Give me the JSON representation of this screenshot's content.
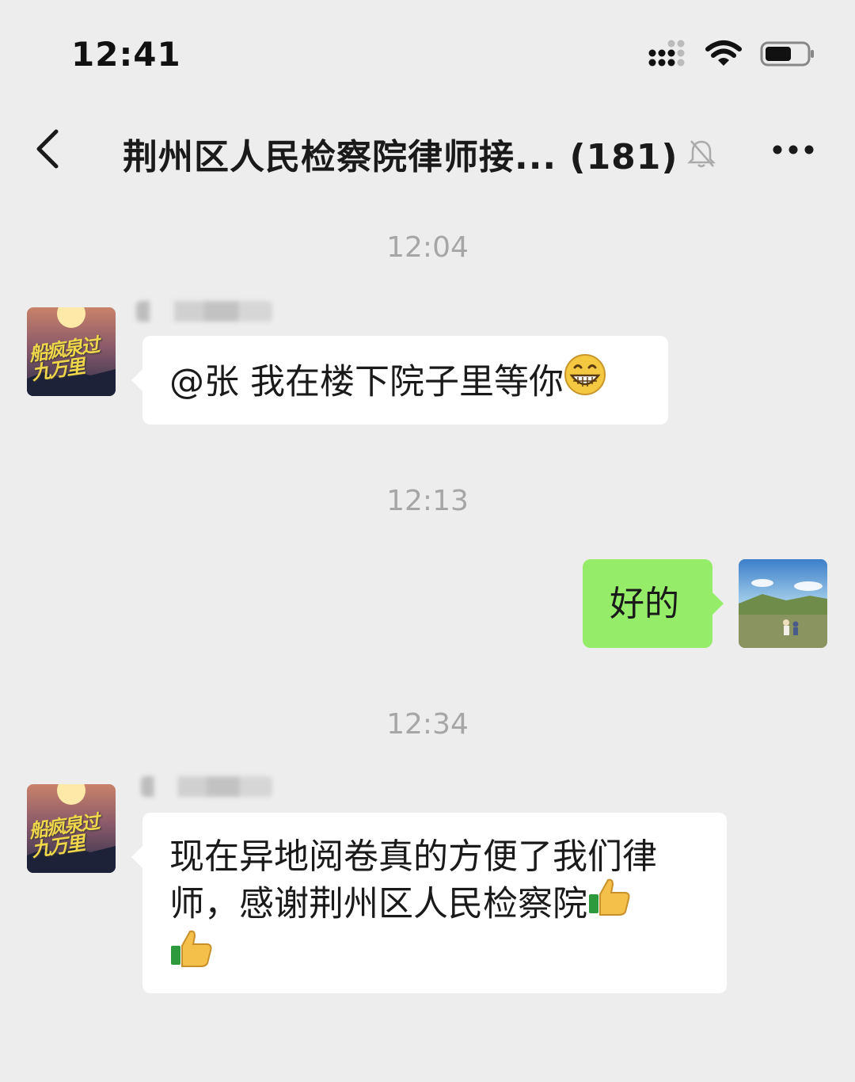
{
  "status_bar": {
    "time": "12:41",
    "icons": [
      "signal-icon",
      "wifi-icon",
      "battery-icon"
    ]
  },
  "nav": {
    "back_icon": "chevron-left-icon",
    "title": "荆州区人民检察院律师接... (181)",
    "mute_icon": "bell-off-icon",
    "more_icon": "more-dots-icon"
  },
  "messages": [
    {
      "timestamp": "12:04",
      "side": "left",
      "text": "@张 我在楼下院子里等你",
      "emoji": "grin-emoji",
      "avatar_text": "船疯泉过九万里"
    },
    {
      "timestamp": "12:13",
      "side": "right",
      "text": "好的",
      "avatar": "landscape-photo"
    },
    {
      "timestamp": "12:34",
      "side": "left",
      "text_line1": "现在异地阅卷真的方便了我们律",
      "text_line2": "师，感谢荆州区人民检察院",
      "emoji": "thumbs-up-emoji",
      "avatar_text": "船疯泉过九万里"
    }
  ],
  "colors": {
    "background": "#ededed",
    "bubble_left": "#ffffff",
    "bubble_right": "#95ec69",
    "timestamp": "#a6a6a6"
  }
}
